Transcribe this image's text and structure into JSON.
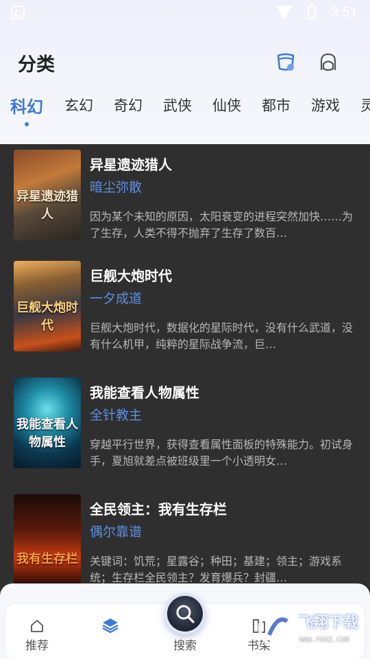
{
  "status_bar": {
    "time": "3:51"
  },
  "header": {
    "title": "分类"
  },
  "tabs": [
    {
      "label": "科幻",
      "active": true
    },
    {
      "label": "玄幻"
    },
    {
      "label": "奇幻"
    },
    {
      "label": "武侠"
    },
    {
      "label": "仙侠"
    },
    {
      "label": "都市"
    },
    {
      "label": "游戏"
    },
    {
      "label": "灵"
    }
  ],
  "books": [
    {
      "title": "异星遗迹猎人",
      "author": "暗尘弥散",
      "description": "因为某个未知的原因，太阳衰变的进程突然加快……为了生存，人类不得不抛弃了生存了数百…",
      "cover_text": "异星遗迹猎人"
    },
    {
      "title": "巨舰大炮时代",
      "author": "一夕成道",
      "description": "巨舰大炮时代，数据化的星际时代，没有什么武道，没有什么机甲，纯粹的星际战争流，巨…",
      "cover_text": "巨舰大炮时代"
    },
    {
      "title": "我能查看人物属性",
      "author": "全针教主",
      "description": "穿越平行世界，获得查看属性面板的特殊能力。初试身手，夏旭就差点被班级里一个小透明女…",
      "cover_text": "我能查看人物属性"
    },
    {
      "title": "全民领主：我有生存栏",
      "author": "偶尔靠谱",
      "description": "关键词：饥荒；星露谷；种田；基建；领主；游戏系统；生存栏全民领主？发育爆兵？封疆…",
      "cover_text": "我有生存栏"
    }
  ],
  "bottom_nav": {
    "items": [
      {
        "label": "推荐"
      },
      {
        "label": "搜索"
      },
      {
        "label": "书架"
      }
    ]
  },
  "watermark": {
    "text": "飞翔下载",
    "sub": "WWW.FXXZ.COM"
  },
  "colors": {
    "accent": "#3d7ad6",
    "author": "#5b8fe3",
    "list_bg": "#2f2f30"
  }
}
